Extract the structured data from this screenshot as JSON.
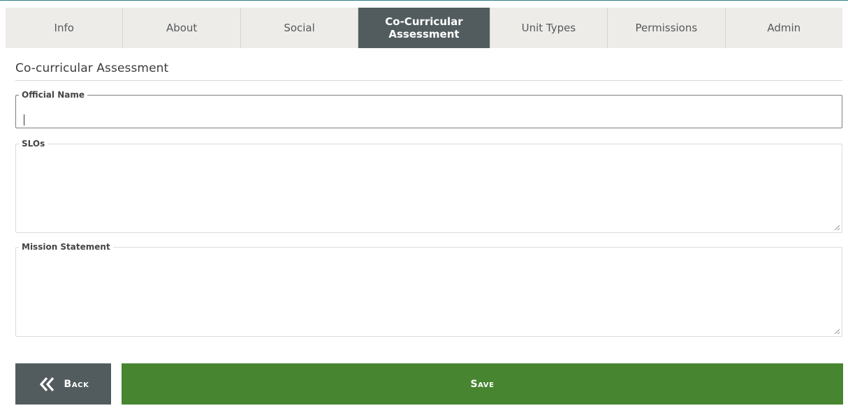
{
  "tabs": [
    {
      "label": "Info",
      "active": false
    },
    {
      "label": "About",
      "active": false
    },
    {
      "label": "Social",
      "active": false
    },
    {
      "label": "Co-Curricular Assessment",
      "active": true
    },
    {
      "label": "Unit Types",
      "active": false
    },
    {
      "label": "Permissions",
      "active": false
    },
    {
      "label": "Admin",
      "active": false
    }
  ],
  "section": {
    "title": "Co-curricular Assessment"
  },
  "form": {
    "official_name": {
      "label": "Official Name",
      "value": ""
    },
    "slos": {
      "label": "SLOs",
      "value": ""
    },
    "mission_statement": {
      "label": "Mission Statement",
      "value": ""
    }
  },
  "buttons": {
    "back_label": "Back",
    "back_icon": "double-chevron-left-icon",
    "save_label": "Save"
  },
  "colors": {
    "tab_bar_bg": "#eeece8",
    "tab_active_bg": "#525c5e",
    "back_button_bg": "#525c5e",
    "save_button_bg": "#478531"
  }
}
